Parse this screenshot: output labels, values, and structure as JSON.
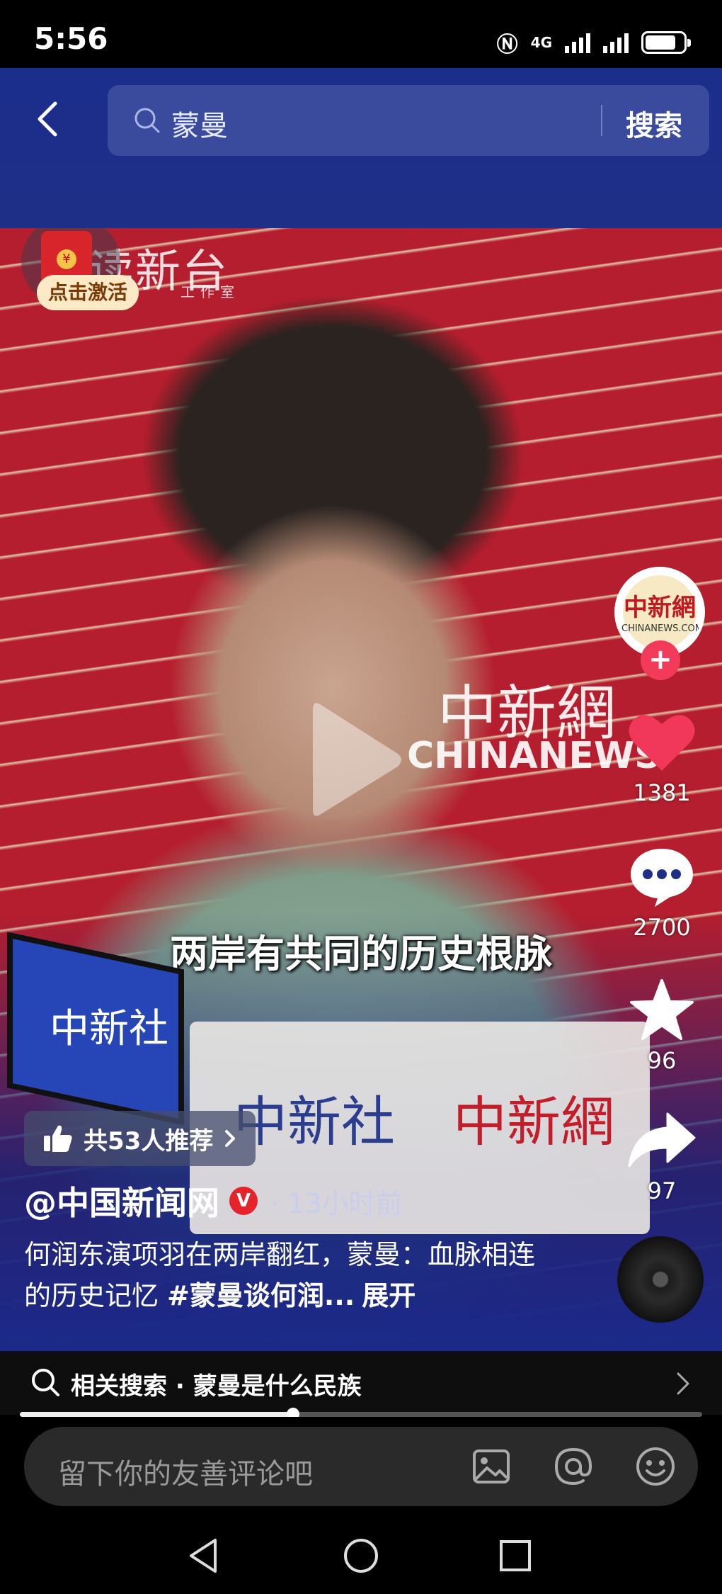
{
  "status_bar": {
    "time": "5:56",
    "network": "4G"
  },
  "header": {
    "search_query": "蒙曼",
    "search_button": "搜索"
  },
  "overlay": {
    "studio_logo": "读新台",
    "studio_sub": "工作室",
    "activate_label": "点击激活",
    "close_symbol": "×",
    "watermark_cn": "中新網",
    "watermark_en": "CHINANEWS",
    "subtitle": "两岸有共同的历史根脉",
    "mic_logo": "中新社",
    "sign_left": "中新社",
    "sign_right": "中新網"
  },
  "rail": {
    "avatar_text": "中新網",
    "avatar_sub": "CHINANEWS.COM",
    "follow_symbol": "+",
    "likes": "1381",
    "comments": "2700",
    "favorites": "96",
    "shares": "97"
  },
  "info": {
    "recommend": "共53人推荐",
    "author": "@中国新闻网",
    "verified_mark": "V",
    "time_ago": "· 13小时前",
    "caption_text": "何润东演项羽在两岸翻红，蒙曼：血脉相连的历史记忆 ",
    "caption_tag": "#蒙曼谈何润...",
    "caption_more": "展开"
  },
  "related": {
    "text": "相关搜索 · 蒙曼是什么民族"
  },
  "progress": {
    "fraction": 0.4
  },
  "comment_bar": {
    "placeholder": "留下你的友善评论吧"
  },
  "colors": {
    "header_bg": "#1c2e8c",
    "like_red": "#f2385a",
    "verified_red": "#e5232b"
  },
  "icons": {
    "back": "back-arrow-icon",
    "search": "search-icon",
    "like": "heart-icon",
    "comment": "comment-icon",
    "favorite": "star-icon",
    "share": "share-icon",
    "image": "image-icon",
    "mention": "at-icon",
    "emoji": "emoji-icon"
  }
}
